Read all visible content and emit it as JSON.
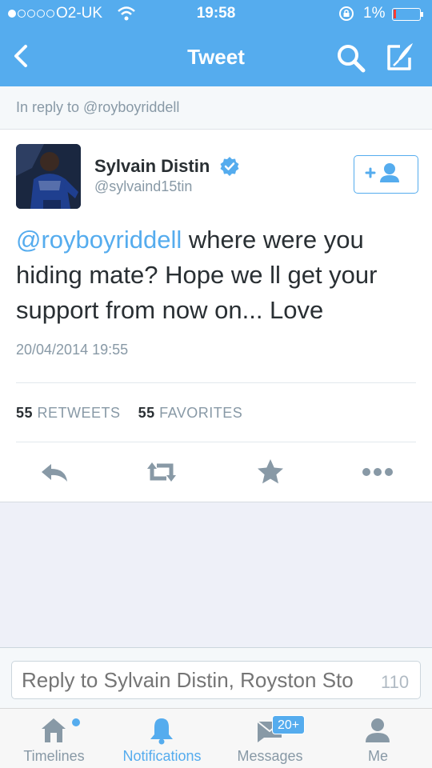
{
  "status_bar": {
    "carrier": "O2-UK",
    "time": "19:58",
    "battery_percent": "1%"
  },
  "nav": {
    "title": "Tweet"
  },
  "reply_context": {
    "text": "In reply to @royboyriddell"
  },
  "tweet": {
    "author_name": "Sylvain Distin",
    "author_handle": "@sylvaind15tin",
    "mention": "@royboyriddell",
    "body": " where were you hiding mate? Hope we ll get your support from now on... Love",
    "timestamp": "20/04/2014 19:55",
    "retweets_count": "55",
    "retweets_label": "RETWEETS",
    "favorites_count": "55",
    "favorites_label": "FAVORITES"
  },
  "composer": {
    "placeholder": "Reply to Sylvain Distin, Royston Sto",
    "char_count": "110"
  },
  "tabbar": {
    "tabs": [
      {
        "label": "Timelines"
      },
      {
        "label": "Notifications"
      },
      {
        "label": "Messages",
        "badge": "20+"
      },
      {
        "label": "Me"
      }
    ]
  },
  "colors": {
    "accent": "#55acee",
    "text": "#292f33",
    "muted": "#8899a6"
  },
  "icons": [
    "back-icon",
    "search-icon",
    "compose-icon",
    "verified-icon",
    "follow-icon",
    "reply-icon",
    "retweet-icon",
    "favorite-icon",
    "more-icon",
    "home-icon",
    "bell-icon",
    "message-icon",
    "person-icon"
  ]
}
